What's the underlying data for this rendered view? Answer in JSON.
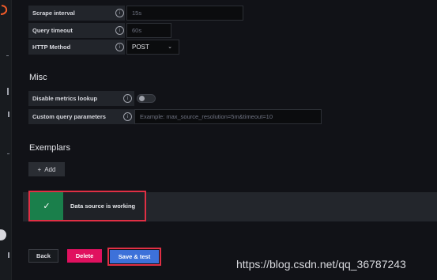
{
  "fields": {
    "scrape_interval": {
      "label": "Scrape interval",
      "placeholder": "15s"
    },
    "query_timeout": {
      "label": "Query timeout",
      "placeholder": "60s"
    },
    "http_method": {
      "label": "HTTP Method",
      "value": "POST"
    }
  },
  "misc": {
    "title": "Misc",
    "disable_metrics_lookup": {
      "label": "Disable metrics lookup",
      "enabled": false
    },
    "custom_query_parameters": {
      "label": "Custom query parameters",
      "placeholder": "Example: max_source_resolution=5m&timeout=10"
    }
  },
  "exemplars": {
    "title": "Exemplars",
    "add_label": "Add"
  },
  "alert": {
    "text": "Data source is working",
    "status": "success"
  },
  "actions": {
    "back_label": "Back",
    "delete_label": "Delete",
    "save_label": "Save & test"
  },
  "watermark": "https://blog.csdn.net/qq_36787243",
  "icons": {
    "info": "info-circle-icon",
    "caret": "chevron-down-icon",
    "add": "plus-icon",
    "check": "check-icon",
    "logo": "grafana-logo-icon"
  },
  "colors": {
    "background": "#111217",
    "success": "#1a7f4b",
    "delete": "#e0115f",
    "primary": "#3d71d9",
    "highlight": "#e02f44"
  }
}
